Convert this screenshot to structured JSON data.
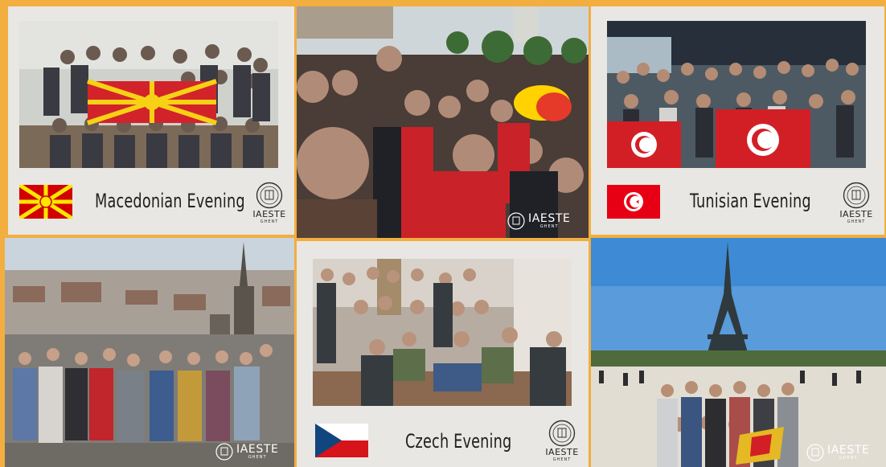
{
  "panels": [
    {
      "id": "macedonian",
      "caption": "Macedonian Evening",
      "flag": "north-macedonia-flag"
    },
    {
      "id": "belgium-crowd",
      "caption": "",
      "flag": ""
    },
    {
      "id": "tunisian",
      "caption": "Tunisian Evening",
      "flag": "tunisia-flag"
    },
    {
      "id": "ghent-view",
      "caption": "",
      "flag": ""
    },
    {
      "id": "czech",
      "caption": "Czech Evening",
      "flag": "czech-flag"
    },
    {
      "id": "paris",
      "caption": "",
      "flag": ""
    }
  ],
  "logo": {
    "name": "IAESTE",
    "sub": "GHENT"
  },
  "colors": {
    "background": "#f2ae3f",
    "card": "#e9e7e3",
    "text": "#1f1f1f"
  }
}
